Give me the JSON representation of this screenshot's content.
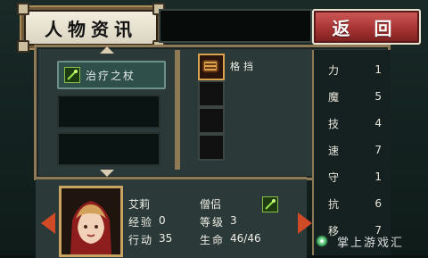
{
  "header": {
    "title": "人物资讯",
    "back_label": "返 回"
  },
  "left_panel": {
    "selected_skill": "治疗之杖"
  },
  "equipment": {
    "selected_item": "格挡"
  },
  "stats": [
    {
      "label": "力",
      "value": "1"
    },
    {
      "label": "魔",
      "value": "5"
    },
    {
      "label": "技",
      "value": "4"
    },
    {
      "label": "速",
      "value": "7"
    },
    {
      "label": "守",
      "value": "1"
    },
    {
      "label": "抗",
      "value": "6"
    },
    {
      "label": "移",
      "value": "7"
    }
  ],
  "character": {
    "name": "艾莉",
    "class": "僧侣",
    "exp_label": "经验",
    "exp": "0",
    "level_label": "等级",
    "level": "3",
    "move_label": "行动",
    "move": "35",
    "hp_label": "生命",
    "hp": "46/46"
  },
  "watermark": {
    "text": "掌上游戏汇"
  },
  "colors": {
    "accent_red": "#a83434",
    "frame_gold": "#8e7a57",
    "panel_teal": "#2b3a38"
  },
  "icons": {
    "staff": "staff-icon",
    "item": "fist-icon",
    "portrait": "character-portrait",
    "watermark_logo": "gear-icon"
  }
}
